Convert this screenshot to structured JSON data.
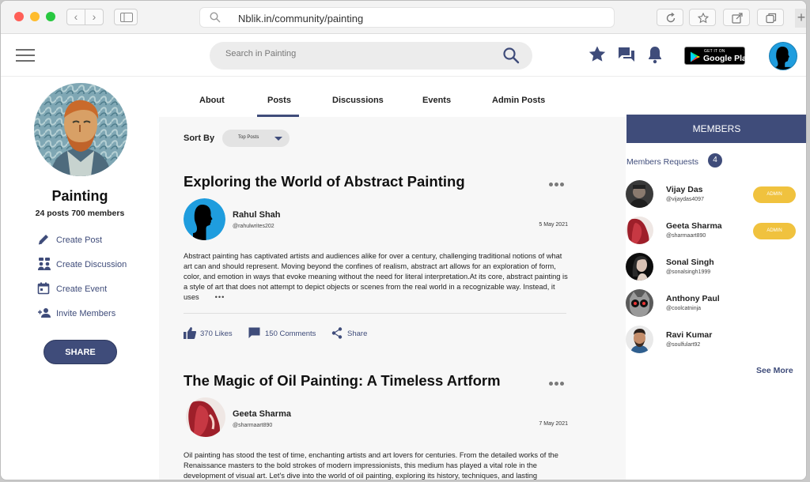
{
  "browser": {
    "url": "Nblik.in/community/painting"
  },
  "header": {
    "search_placeholder": "Search in Painting",
    "store_badge": {
      "small": "GET IT ON",
      "big": "Google Play"
    }
  },
  "tabs": [
    "About",
    "Posts",
    "Discussions",
    "Events",
    "Admin Posts"
  ],
  "active_tab": "Posts",
  "group": {
    "name": "Painting",
    "stats": "24 posts  700 members",
    "actions": [
      "Create Post",
      "Create Discussion",
      "Create Event",
      "Invite Members"
    ],
    "share_label": "SHARE"
  },
  "feed": {
    "sort_label": "Sort By",
    "sort_value": "Top Posts",
    "posts": [
      {
        "title": "Exploring the World of Abstract Painting",
        "author": "Rahul Shah",
        "handle": "@rahulwrites202",
        "date": "5 May 2021",
        "body": "Abstract painting has captivated artists and audiences alike for over a century, challenging traditional notions of what art can and should represent. Moving beyond the confines of realism, abstract art allows for an exploration of form, color, and emotion in ways that evoke meaning without the need for literal interpretation.At its core, abstract painting is a style of art that does not attempt to depict objects or scenes from the real world in a recognizable way. Instead, it uses",
        "more": "•••",
        "likes": "370 Likes",
        "comments": "150 Comments",
        "share": "Share"
      },
      {
        "title": "The Magic of Oil Painting: A Timeless Artform",
        "author": "Geeta Sharma",
        "handle": "@sharmaart890",
        "date": "7 May 2021",
        "body": "Oil painting has stood the test of time, enchanting artists and art lovers for centuries. From the detailed works of the Renaissance masters to the bold strokes of modern impressionists, this medium has played a vital role in the development of visual art. Let's dive into the world of oil painting, exploring its history, techniques, and lasting"
      }
    ]
  },
  "members": {
    "title": "MEMBERS",
    "requests_label": "Members Requests",
    "requests_count": "4",
    "admin_label": "ADMIN",
    "list": [
      {
        "name": "Vijay Das",
        "handle": "@vijaydas4097",
        "admin": true
      },
      {
        "name": "Geeta Sharma",
        "handle": "@sharmaart890",
        "admin": true
      },
      {
        "name": "Sonal Singh",
        "handle": "@sonalsingh1999",
        "admin": false
      },
      {
        "name": "Anthony Paul",
        "handle": "@coolcatninja",
        "admin": false
      },
      {
        "name": "Ravi Kumar",
        "handle": "@soulfulart92",
        "admin": false
      }
    ],
    "see_more": "See More"
  },
  "colors": {
    "brand": "#3f4c7a",
    "admin": "#f0c23e",
    "avatar_blue": "#1f9dde"
  }
}
